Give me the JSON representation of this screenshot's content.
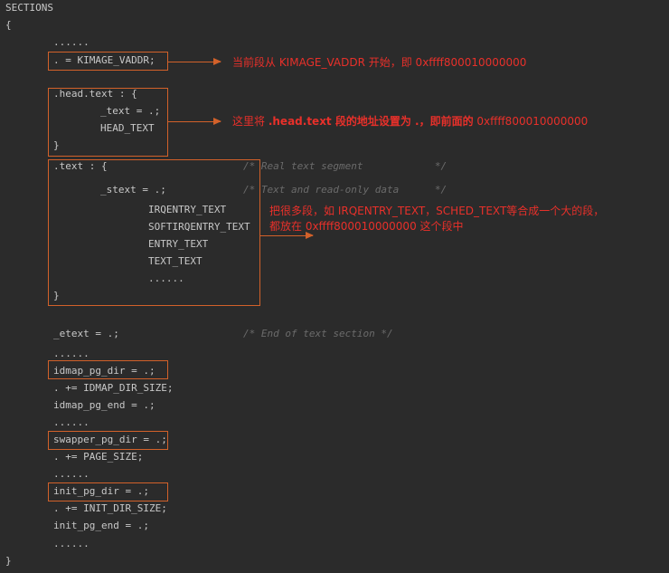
{
  "lines": {
    "sections": "SECTIONS",
    "open_brace": "{",
    "dots1": "......",
    "kimage": ". = KIMAGE_VADDR;",
    "head_text": ".head.text : {",
    "text_assign": "_text = .;",
    "head_text_macro": "HEAD_TEXT",
    "close1": "}",
    "text_sec": ".text : {",
    "stext": "_stext = .;",
    "irqentry": "IRQENTRY_TEXT",
    "softirq": "SOFTIRQENTRY_TEXT",
    "entry": "ENTRY_TEXT",
    "text_text": "TEXT_TEXT",
    "dots2": "......",
    "close2": "}",
    "etext": "_etext = .;",
    "dots3": "......",
    "idmap_dir": "idmap_pg_dir = .;",
    "idmap_size": ". += IDMAP_DIR_SIZE;",
    "idmap_end": "idmap_pg_end = .;",
    "dots4": "......",
    "swapper_dir": "swapper_pg_dir = .;",
    "page_size": ". += PAGE_SIZE;",
    "dots5": "......",
    "init_dir": "init_pg_dir = .;",
    "init_size": ". += INIT_DIR_SIZE;",
    "init_end": "init_pg_end = .;",
    "dots6": "......",
    "close_final": "}"
  },
  "comments": {
    "real_text": "/* Real text segment            */",
    "text_ro": "/* Text and read-only data      */",
    "end_text": "/* End of text section */"
  },
  "annotations": {
    "a1": "当前段从 KIMAGE_VADDR 开始，即 0xffff800010000000",
    "a2_prefix": "这里将 ",
    "a2_bold": ".head.text 段的地址设置为 .，即前面的",
    "a2_suffix": " 0xffff800010000000",
    "a3_line1": "把很多段，如 IRQENTRY_TEXT，SCHED_TEXT等合成一个大的段，",
    "a3_line2": "都放在 0xffff800010000000 这个段中"
  },
  "colors": {
    "background": "#2b2b2b",
    "code_text": "#c8c8c8",
    "comment": "#6b6b6b",
    "box_border": "#d2612a",
    "annotation": "#e8302a"
  }
}
